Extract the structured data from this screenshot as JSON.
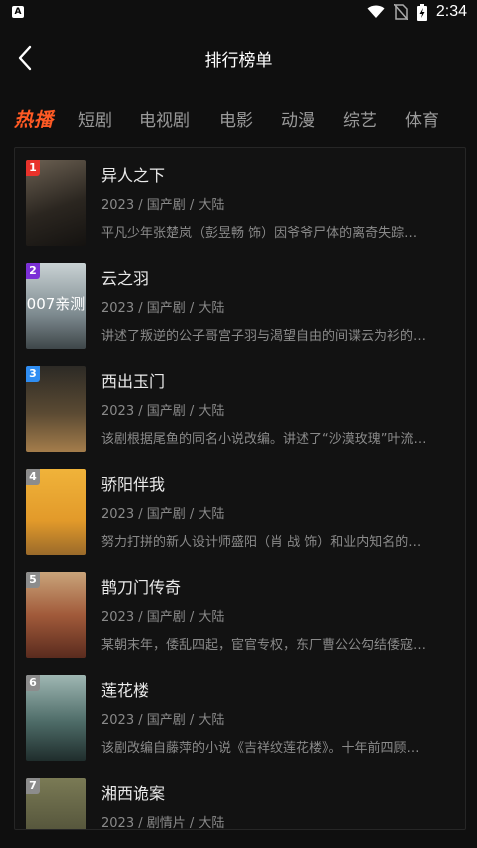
{
  "status_bar": {
    "time": "2:34",
    "left_icon": "A"
  },
  "header": {
    "title": "排行榜单"
  },
  "tabs": [
    "热播",
    "短剧",
    "电视剧",
    "电影",
    "动漫",
    "综艺",
    "体育"
  ],
  "active_tab": "热播",
  "items": [
    {
      "rank": "1",
      "rank_color": "#e8322b",
      "name": "异人之下",
      "meta": "2023 / 国产剧 / 大陆",
      "desc": "平凡少年张楚岚（彭昱畅 饰）因爷爷尸体的离奇失踪…",
      "poster_text": "",
      "poster_bg": "linear-gradient(160deg,#6b6052 0%,#2b2620 55%,#141210 100%)"
    },
    {
      "rank": "2",
      "rank_color": "#7b2fd6",
      "name": "云之羽",
      "meta": "2023 / 国产剧 / 大陆",
      "desc": "讲述了叛逆的公子哥宫子羽与渴望自由的间谍云为衫的…",
      "poster_text": "007亲测",
      "poster_bg": "linear-gradient(180deg,#c9d2d4 0%,#7d8a8f 60%,#3e4649 100%)"
    },
    {
      "rank": "3",
      "rank_color": "#2f8df2",
      "name": "西出玉门",
      "meta": "2023 / 国产剧 / 大陆",
      "desc": "该剧根据尾鱼的同名小说改编。讲述了“沙漠玫瑰”叶流…",
      "poster_text": "",
      "poster_bg": "linear-gradient(180deg,#2c2a25 0%,#5b4a33 55%,#a47d4b 100%)"
    },
    {
      "rank": "4",
      "rank_color": "#8c8c8c",
      "name": "骄阳伴我",
      "meta": "2023 / 国产剧 / 大陆",
      "desc": "努力打拼的新人设计师盛阳（肖 战 饰）和业内知名的…",
      "poster_text": "",
      "poster_bg": "linear-gradient(180deg,#f0b33a 0%,#e29a2a 60%,#9a6a2a 100%)"
    },
    {
      "rank": "5",
      "rank_color": "#8c8c8c",
      "name": "鹊刀门传奇",
      "meta": "2023 / 国产剧 / 大陆",
      "desc": "某朝末年，倭乱四起，宦官专权，东厂曹公公勾结倭寇…",
      "poster_text": "",
      "poster_bg": "linear-gradient(180deg,#c9a47a 0%,#a15a3a 50%,#5a2b1e 100%)"
    },
    {
      "rank": "6",
      "rank_color": "#8c8c8c",
      "name": "莲花楼",
      "meta": "2023 / 国产剧 / 大陆",
      "desc": "该剧改编自藤萍的小说《吉祥纹莲花楼》。十年前四顾…",
      "poster_text": "",
      "poster_bg": "linear-gradient(180deg,#9fb7b3 0%,#4d6b67 55%,#1f2d2c 100%)"
    },
    {
      "rank": "7",
      "rank_color": "#8c8c8c",
      "name": "湘西诡案",
      "meta": "2023 / 剧情片 / 大陆",
      "desc": "",
      "poster_text": "",
      "poster_bg": "linear-gradient(180deg,#7a7a55 0%,#3f3f2c 100%)"
    }
  ]
}
